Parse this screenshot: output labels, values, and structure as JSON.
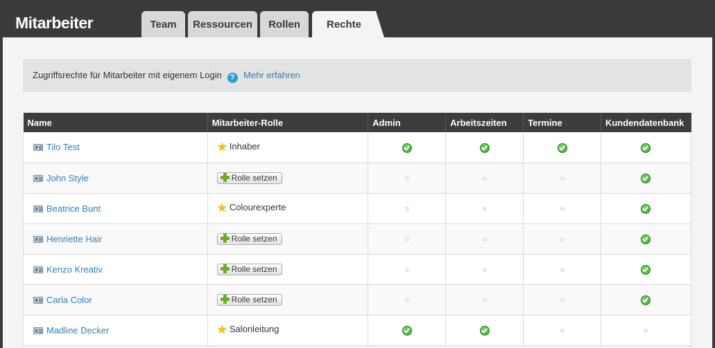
{
  "app": {
    "title": "Mitarbeiter"
  },
  "tabs": [
    {
      "label": "Team",
      "active": false
    },
    {
      "label": "Ressourcen",
      "active": false
    },
    {
      "label": "Rollen",
      "active": false
    },
    {
      "label": "Rechte",
      "active": true
    }
  ],
  "info": {
    "text": "Zugriffsrechte für Mitarbeiter mit eigenem Login",
    "help_icon": "question-circle-icon",
    "link_label": "Mehr erfahren"
  },
  "table": {
    "columns": [
      "Name",
      "Mitarbeiter-Rolle",
      "Admin",
      "Arbeitszeiten",
      "Termine",
      "Kundendatenbank"
    ],
    "set_role_label": "Rolle setzen",
    "rows": [
      {
        "name": "Tilo Test",
        "role": "Inhaber",
        "perms": [
          true,
          true,
          true,
          true
        ]
      },
      {
        "name": "John Style",
        "role": null,
        "perms": [
          false,
          false,
          false,
          true
        ]
      },
      {
        "name": "Beatrice Bunt",
        "role": "Colourexperte",
        "perms": [
          false,
          false,
          false,
          true
        ]
      },
      {
        "name": "Henriette Hair",
        "role": null,
        "perms": [
          false,
          false,
          false,
          true
        ]
      },
      {
        "name": "Kenzo Kreativ",
        "role": null,
        "perms": [
          false,
          false,
          false,
          true
        ]
      },
      {
        "name": "Carla Color",
        "role": null,
        "perms": [
          false,
          false,
          false,
          true
        ]
      },
      {
        "name": "Madline Decker",
        "role": "Salonleitung",
        "perms": [
          true,
          true,
          false,
          false
        ]
      }
    ]
  },
  "colors": {
    "header_bg": "#3a3a3a",
    "link": "#2f7fb8",
    "check": "#35a02a",
    "star": "#f2c11b"
  }
}
